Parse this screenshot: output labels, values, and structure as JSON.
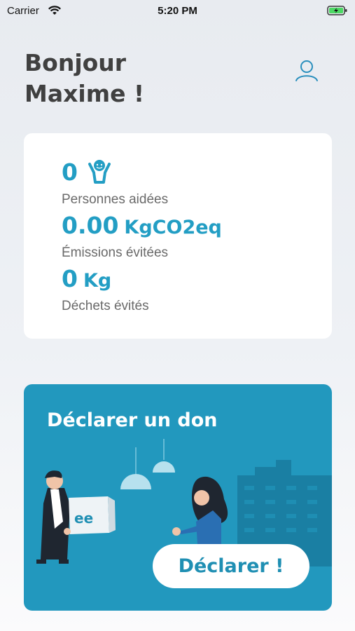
{
  "status_bar": {
    "carrier": "Carrier",
    "time": "5:20 PM",
    "icons": [
      "wifi-icon",
      "battery-icon"
    ]
  },
  "header": {
    "greeting_line1": "Bonjour",
    "greeting_line2": "Maxime !",
    "profile_icon": "user-icon"
  },
  "stats": {
    "people_helped": {
      "value": "0",
      "label": "Personnes aidées",
      "icon": "people-icon"
    },
    "emissions": {
      "value": "0.00",
      "unit": "KgCO2eq",
      "label": "Émissions évitées"
    },
    "waste": {
      "value": "0",
      "unit": "Kg",
      "label": "Déchets évités"
    }
  },
  "donation": {
    "title": "Déclarer un don",
    "button_label": "Déclarer !",
    "box_logo_text": "ee"
  },
  "colors": {
    "accent": "#239ec4",
    "card_bg": "#2298be",
    "text_dark": "#404040"
  }
}
